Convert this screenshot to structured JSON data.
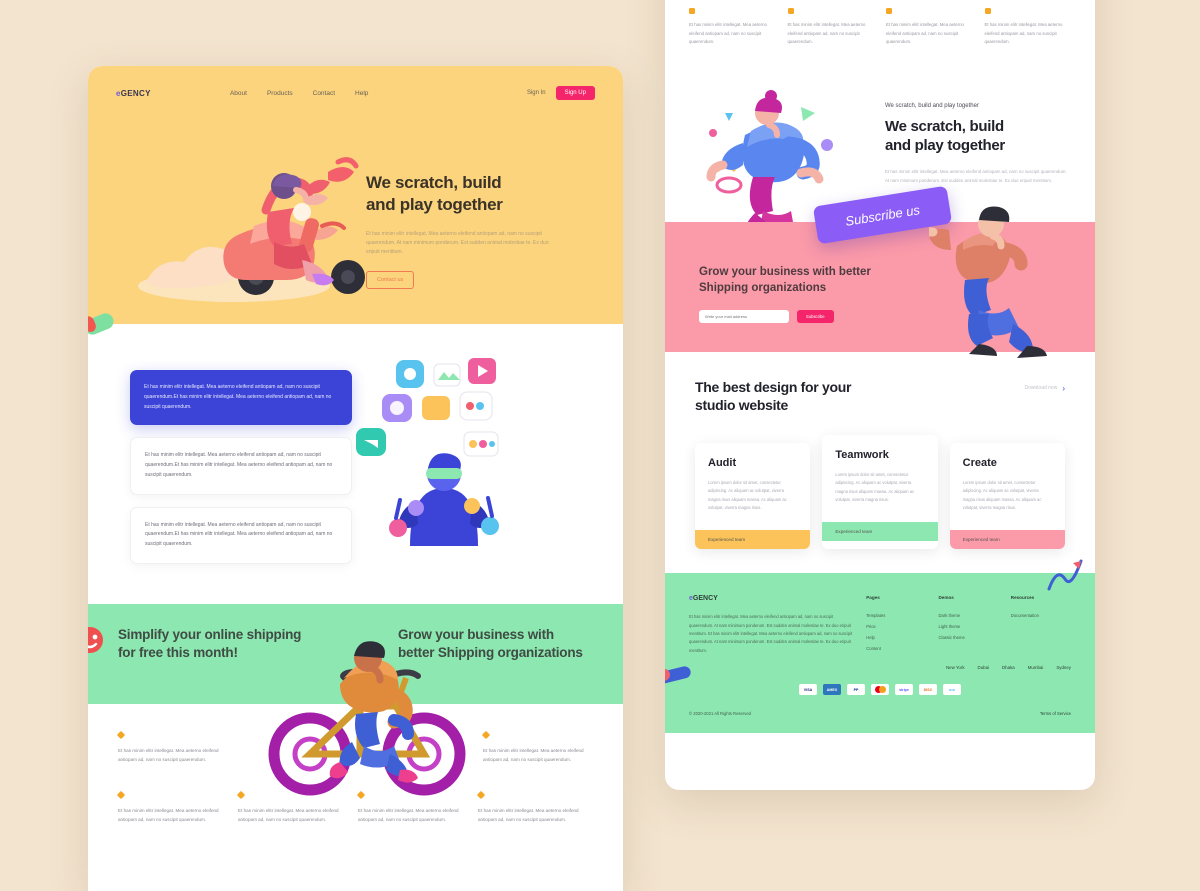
{
  "lorem": {
    "short": "Et has minim elitr intellegat. Mea aeterno eleifend antiopam ad, nam no suscipit quaerendum.",
    "medium": "Et has minim elitr intellegat. Mea aeterno eleifend antiopam ad, nam no suscipit quaerendum.Et has minim elitr intellegat. Mea aeterno eleifend antiopam ad, nam no suscipit quaerendum.",
    "hero": "Et has minim elitr intellegat. Mea aeterno eleifend antiopam ad, nam no suscipit quaerendum. At nam minimum ponderum. Est sudden animal molestiae te. Ex duo eripuit mentitum.",
    "card": "Lorem ipsum dolor sit amet, consectetur adipiscing. Ac aliquam ac volutpat, viverra magna risus aliquam massa. Ac aliquam ac volutpat, viverra magna risus.",
    "footer": "Et has minim elitr intellegat. Mea aeterno eleifend antiopam ad, nam no suscipit quaerendum. At nam minimum ponderum. Est sudden animal molestiae te. Ex duo eripuit mentitum. Et has minim elitr intellegat. Mea aeterno eleifend antiopam ad, nam no suscipit quaerendum. At nam minimum ponderum. Est sudden animal molestiae te. Ex duo eripuit mentitum."
  },
  "colors": {
    "hero_yellow": "#fbd47d",
    "accent_pink": "#f5256b",
    "card_blue": "#3b44d6",
    "band_green": "#8ce8b0",
    "band_pink": "#fb9aa8",
    "badge_purple": "#8b5cf6",
    "page_bg": "#f3e4cf"
  },
  "left_page": {
    "nav": {
      "logo": "eGENCY",
      "logo_prefix": "e",
      "logo_rest": "GENCY",
      "links": [
        {
          "label": "About"
        },
        {
          "label": "Products"
        },
        {
          "label": "Contact"
        },
        {
          "label": "Help"
        }
      ],
      "signin_label": "Sign In",
      "signup_label": "Sign Up"
    },
    "hero": {
      "heading_line1": "We scratch, build",
      "heading_line2": "and play together",
      "paragraph": "Et has minim elitr intellegat. Mea aeterno eleifend antiopam ad, nam no suscipit quaerendum. At nam minimum ponderum. Est sudden animal molestiae te. Ex duo eripuit mentitum.",
      "cta_label": "Contact us"
    },
    "cards": [
      {
        "style": "blue",
        "text": "Et has minim elitr intellegat. Mea aeterno eleifend antiopam ad, nam no suscipit quaerendum.Et has minim elitr intellegat. Mea aeterno eleifend antiopam ad, nam no suscipit quaerendum."
      },
      {
        "style": "plain",
        "text": "Et has minim elitr intellegat. Mea aeterno eleifend antiopam ad, nam no suscipit quaerendum.Et has minim elitr intellegat. Mea aeterno eleifend antiopam ad, nam no suscipit quaerendum."
      },
      {
        "style": "plain",
        "text": "Et has minim elitr intellegat. Mea aeterno eleifend antiopam ad, nam no suscipit quaerendum.Et has minim elitr intellegat. Mea aeterno eleifend antiopam ad, nam no suscipit quaerendum."
      }
    ],
    "green_band": {
      "left_heading": "Simplify your online shipping for free this month!",
      "right_heading": "Grow your business with better Shipping organizations"
    },
    "features_row1": [
      {
        "text": "Et has minim elitr intellegat. Mea aeterno eleifend antiopam ad, nam no suscipit quaerendum."
      },
      {
        "text": "Et has minim elitr intellegat. Mea aeterno eleifend antiopam ad, nam no suscipit quaerendum."
      }
    ],
    "features_row2": [
      {
        "text": "Et has minim elitr intellegat. Mea aeterno eleifend antiopam ad, nam no suscipit quaerendum."
      },
      {
        "text": "Et has minim elitr intellegat. Mea aeterno eleifend antiopam ad, nam no suscipit quaerendum."
      },
      {
        "text": "Et has minim elitr intellegat. Mea aeterno eleifend antiopam ad, nam no suscipit quaerendum."
      },
      {
        "text": "Et has minim elitr intellegat. Mea aeterno eleifend antiopam ad, nam no suscipit quaerendum."
      }
    ]
  },
  "right_page": {
    "top_features": [
      {
        "text": "Et has minim elitr intellegat. Mea aeterno eleifend antiopam ad, nam no suscipit quaerendum."
      },
      {
        "text": "Et has minim elitr intellegat. Mea aeterno eleifend antiopam ad, nam no suscipit quaerendum."
      },
      {
        "text": "Et has minim elitr intellegat. Mea aeterno eleifend antiopam ad, nam no suscipit quaerendum."
      },
      {
        "text": "Et has minim elitr intellegat. Mea aeterno eleifend antiopam ad, nam no suscipit quaerendum."
      }
    ],
    "scratch": {
      "eyebrow": "We scratch, build and play together",
      "heading_line1": "We scratch, build",
      "heading_line2": "and play together",
      "paragraph": "Et has minim elitr intellegat. Mea aeterno eleifend antiopam ad, nam no suscipit quaerendum. At nam minimum ponderum. Est sudden animal molestiae te. Ex duo eripuit mentitum."
    },
    "subscribe": {
      "badge_label": "Subscribe us",
      "heading_line1": "Grow your business with better",
      "heading_line2": "Shipping organizations",
      "input_placeholder": "Write your mail address",
      "button_label": "Subscribe"
    },
    "best": {
      "heading_line1": "The best design for your",
      "heading_line2": "studio website",
      "link_label": "Download now",
      "cards": [
        {
          "title": "Audit",
          "body": "Lorem ipsum dolor sit amet, consectetur adipiscing. Ac aliquam ac volutpat, viverra magna risus aliquam massa. Ac aliquam ac volutpat, viverra magna risus.",
          "footer_label": "Experienced team",
          "footer_color": "#fbc35a"
        },
        {
          "title": "Teamwork",
          "body": "Lorem ipsum dolor sit amet, consectetur adipiscing. Ac aliquam ac volutpat, viverra magna risus aliquam massa. Ac aliquam ac volutpat, viverra magna risus.",
          "footer_label": "Experienced team",
          "footer_color": "#8ce8b0"
        },
        {
          "title": "Create",
          "body": "Lorem ipsum dolor sit amet, consectetur adipiscing. Ac aliquam ac volutpat, viverra magna risus aliquam massa. Ac aliquam ac volutpat, viverra magna risus.",
          "footer_label": "Experienced team",
          "footer_color": "#fb9aa8"
        }
      ]
    },
    "footer": {
      "logo_prefix": "e",
      "logo_rest": "GENCY",
      "about": "Et has minim elitr intellegat. Mea aeterno eleifend antiopam ad, nam no suscipit quaerendum. At nam minimum ponderum. Est sudden animal molestiae te. Ex duo eripuit mentitum. Et has minim elitr intellegat. Mea aeterno eleifend antiopam ad, nam no suscipit quaerendum. At nam minimum ponderum. Est sudden animal molestiae te. Ex duo eripuit mentitum.",
      "columns": [
        {
          "title": "Pages",
          "links": [
            "Templates",
            "Price",
            "Help",
            "Content"
          ]
        },
        {
          "title": "Demos",
          "links": [
            "Dark theme",
            "Light theme",
            "Classic theme"
          ]
        },
        {
          "title": "Resources",
          "links": [
            "Documentation"
          ]
        }
      ],
      "cities": [
        "New York",
        "Dubai",
        "Dhaka",
        "Mumbai",
        "Sydney"
      ],
      "payments": [
        "VISA",
        "AMEX",
        "PayPal",
        "Mastercard",
        "Stripe",
        "Discover",
        "Maestro"
      ],
      "copyright": "© 2020-2021 All Rights Reserved",
      "terms_label": "Terms of Service"
    }
  }
}
